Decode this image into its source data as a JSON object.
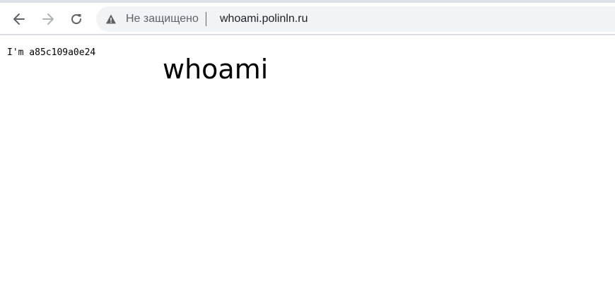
{
  "browser": {
    "security_label": "Не защищено",
    "url": "whoami.polinln.ru",
    "icons": {
      "back": "arrow-left-icon",
      "forward": "arrow-right-icon",
      "reload": "reload-icon",
      "security": "warning-triangle-icon"
    },
    "colors": {
      "icon_active": "#5f6368",
      "icon_disabled": "#b0b3b7",
      "omnibox_bg": "#f1f3f4"
    }
  },
  "page": {
    "hostname_line": "I'm a85c109a0e24",
    "title": "whoami"
  }
}
